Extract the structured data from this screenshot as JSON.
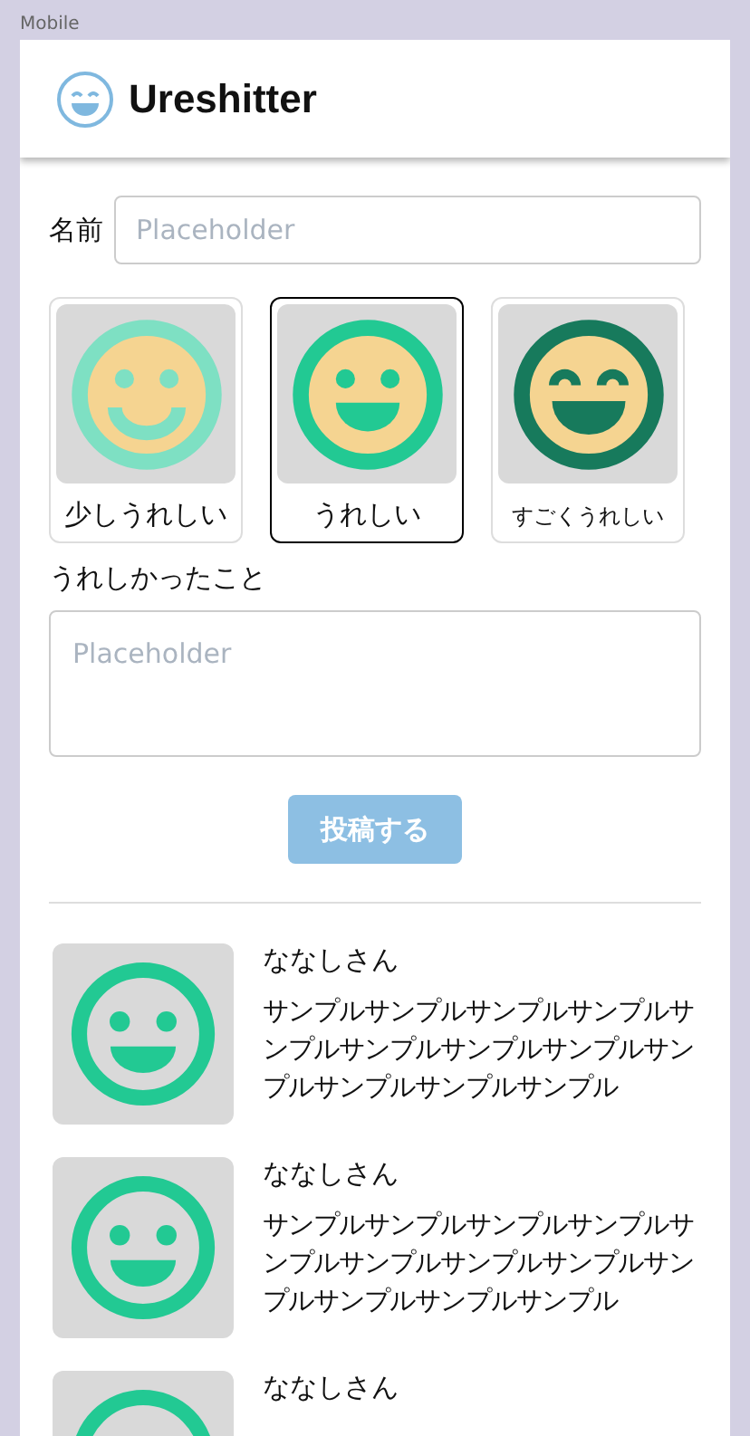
{
  "frame_label": "Mobile",
  "header": {
    "title": "Ureshitter"
  },
  "name_field": {
    "label": "名前",
    "placeholder": "Placeholder"
  },
  "moods": [
    {
      "kind": "slight",
      "label": "少しうれしい",
      "selected": false
    },
    {
      "kind": "happy",
      "label": "うれしい",
      "selected": true
    },
    {
      "kind": "very",
      "label": "すごくうれしい",
      "selected": false
    }
  ],
  "comment_field": {
    "label": "うれしかったこと",
    "placeholder": "Placeholder"
  },
  "submit_button": {
    "label": "投稿する",
    "disabled": true
  },
  "posts": [
    {
      "kind": "happy",
      "author": "ななしさん",
      "text": "サンプルサンプルサンプルサンプルサンプルサンプルサンプルサンプルサンプルサンプルサンプルサンプル"
    },
    {
      "kind": "happy",
      "author": "ななしさん",
      "text": "サンプルサンプルサンプルサンプルサンプルサンプルサンプルサンプルサンプルサンプルサンプルサンプル"
    },
    {
      "kind": "happy",
      "author": "ななしさん"
    }
  ]
}
